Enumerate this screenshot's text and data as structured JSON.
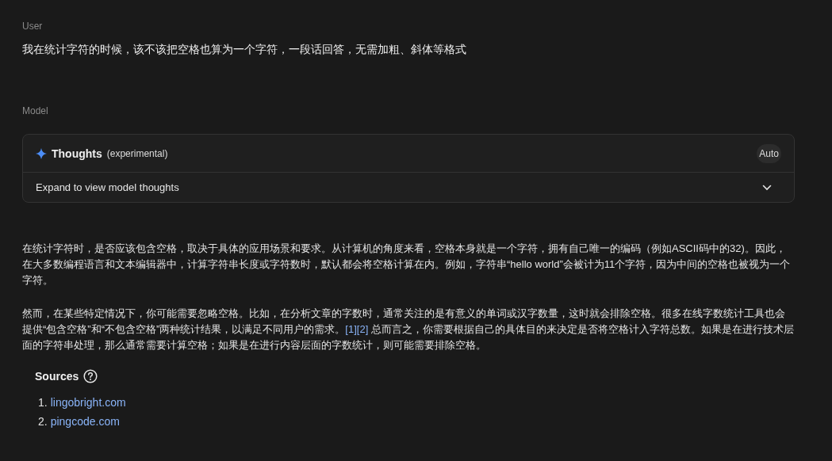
{
  "user_turn": {
    "role": "User",
    "text": "我在统计字符的时候，该不该把空格也算为一个字符，一段话回答，无需加粗、斜体等格式"
  },
  "model_turn": {
    "role": "Model",
    "thoughts": {
      "title": "Thoughts",
      "tag": "(experimental)",
      "mode": "Auto",
      "expand_label": "Expand to view model thoughts",
      "expanded": false
    },
    "paragraphs": [
      {
        "before": "在统计字符时，是否应该包含空格，取决于具体的应用场景和要求。从计算机的角度来看，空格本身就是一个字符，拥有自己唯一的编码（例如ASCII码中的32)。因此，在大多数编程语言和文本编辑器中，计算字符串长度或字符数时，默认都会将空格计算在内。例如，字符串“hello world”会被计为11个字符，因为中间的空格也被视为一个字符。"
      },
      {
        "before": "然而，在某些特定情况下，你可能需要忽略空格。比如，在分析文章的字数时，通常关注的是有意义的单词或汉字数量，这时就会排除空格。很多在线字数统计工具也会提供“包含空格”和“不包含空格”两种统计结果，以满足不同用户的需求。",
        "citations": [
          "[1]",
          "[2]"
        ],
        "after": " 总而言之，你需要根据自己的具体目的来决定是否将空格计入字符总数。如果是在进行技术层面的字符串处理，那么通常需要计算空格；如果是在进行内容层面的字数统计，则可能需要排除空格。"
      }
    ],
    "sources": {
      "title": "Sources",
      "items": [
        {
          "number": "1.",
          "label": "lingobright.com"
        },
        {
          "number": "2.",
          "label": "pingcode.com"
        }
      ]
    }
  }
}
